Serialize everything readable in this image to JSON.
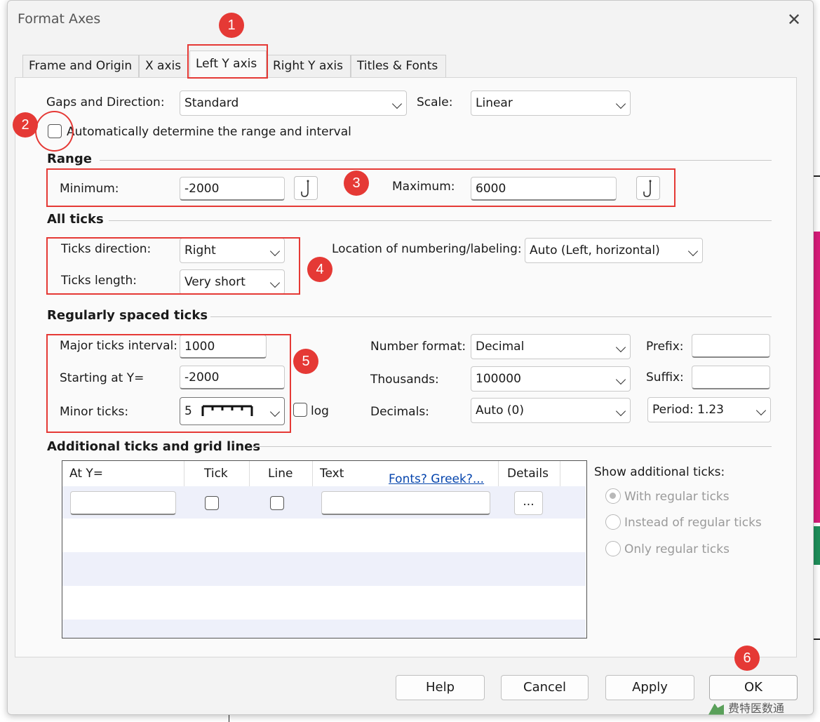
{
  "window": {
    "title": "Format Axes"
  },
  "tabs": [
    "Frame and Origin",
    "X axis",
    "Left Y axis",
    "Right Y axis",
    "Titles & Fonts"
  ],
  "active_tab": "Left Y axis",
  "gaps": {
    "label": "Gaps and Direction:",
    "value": "Standard"
  },
  "scale": {
    "label": "Scale:",
    "value": "Linear"
  },
  "auto_range": {
    "label": "Automatically determine the range and interval",
    "checked": false
  },
  "range": {
    "heading": "Range",
    "min_label": "Minimum:",
    "min_value": "-2000",
    "max_label": "Maximum:",
    "max_value": "6000"
  },
  "all_ticks": {
    "heading": "All ticks",
    "direction_label": "Ticks direction:",
    "direction_value": "Right",
    "length_label": "Ticks length:",
    "length_value": "Very short",
    "location_label": "Location of numbering/labeling:",
    "location_value": "Auto (Left, horizontal)"
  },
  "regular_ticks": {
    "heading": "Regularly spaced ticks",
    "major_label": "Major ticks interval:",
    "major_value": "1000",
    "start_label": "Starting at Y=",
    "start_value": "-2000",
    "minor_label": "Minor ticks:",
    "minor_value": "5",
    "log_label": "log",
    "number_format_label": "Number format:",
    "number_format_value": "Decimal",
    "thousands_label": "Thousands:",
    "thousands_value": "100000",
    "decimals_label": "Decimals:",
    "decimals_value": "Auto (0)",
    "prefix_label": "Prefix:",
    "prefix_value": "",
    "suffix_label": "Suffix:",
    "suffix_value": "",
    "period_value": "Period: 1.23"
  },
  "additional": {
    "heading": "Additional ticks and grid lines",
    "columns": [
      "At Y=",
      "Tick",
      "Line",
      "Text",
      "Details"
    ],
    "fonts_link": "Fonts? Greek?...",
    "details_button": "...",
    "show_label": "Show additional ticks:",
    "options": [
      "With regular ticks",
      "Instead of regular ticks",
      "Only regular ticks"
    ],
    "selected_option": "With regular ticks"
  },
  "buttons": {
    "help": "Help",
    "cancel": "Cancel",
    "apply": "Apply",
    "ok": "OK"
  },
  "badges": [
    "1",
    "2",
    "3",
    "4",
    "5",
    "6"
  ],
  "watermark": "费特医数通",
  "colors": {
    "highlight": "#e53935",
    "dialog_bg": "#f3f3f3",
    "link": "#0645ad"
  }
}
